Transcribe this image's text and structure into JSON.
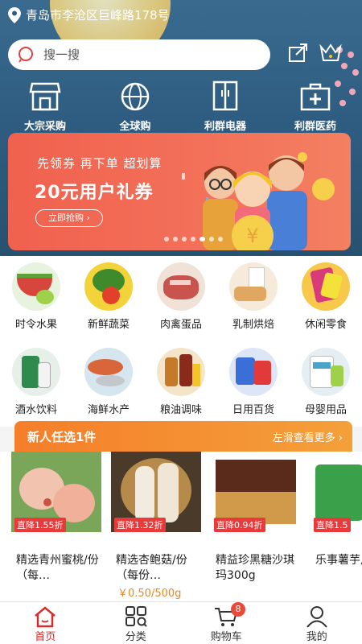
{
  "header": {
    "location": "青岛市李沧区巨峰路178号",
    "search_placeholder": "搜一搜",
    "share_icon": "share-icon",
    "crown_icon": "crown-basket-icon"
  },
  "categories_top": [
    {
      "label": "大宗采购",
      "icon": "store-icon"
    },
    {
      "label": "全球购",
      "icon": "globe-icon"
    },
    {
      "label": "利群电器",
      "icon": "fridge-icon"
    },
    {
      "label": "利群医药",
      "icon": "medkit-icon"
    }
  ],
  "banner": {
    "line1": "先领券 再下单 超划算",
    "line2": "20元用户礼券",
    "button": "立即抢购 ›",
    "dots_total": 7,
    "dots_active": 5
  },
  "grid": [
    {
      "label": "时令水果",
      "color": "#7cc34a"
    },
    {
      "label": "新鲜蔬菜",
      "color": "#4e9a3a"
    },
    {
      "label": "肉禽蛋品",
      "color": "#c9544d"
    },
    {
      "label": "乳制烘焙",
      "color": "#e8c79a"
    },
    {
      "label": "休闲零食",
      "color": "#f0b73a"
    },
    {
      "label": "酒水饮料",
      "color": "#2f8a4e"
    },
    {
      "label": "海鲜水产",
      "color": "#d8663a"
    },
    {
      "label": "粮油调味",
      "color": "#c47a2a"
    },
    {
      "label": "日用百货",
      "color": "#3a6fd8"
    },
    {
      "label": "母婴用品",
      "color": "#4aa3c8"
    }
  ],
  "new_user": {
    "title": "新人任选1件",
    "more": "左滑查看更多 ›"
  },
  "products": [
    {
      "tag": "直降1.55折",
      "name": "精选青州蜜桃/份（每…",
      "price": ""
    },
    {
      "tag": "直降1.32折",
      "name": "精选杏鲍菇/份（每份…",
      "price": "￥0.50/500g"
    },
    {
      "tag": "直降0.94折",
      "name": "精益珍黑糖沙琪玛300g",
      "price": ""
    },
    {
      "tag": "直降1.5",
      "name": "乐事薯芋片沁",
      "price": ""
    }
  ],
  "tabbar": [
    {
      "label": "首页",
      "icon": "home-icon",
      "active": true
    },
    {
      "label": "分类",
      "icon": "category-icon",
      "active": false
    },
    {
      "label": "购物车",
      "icon": "cart-icon",
      "active": false,
      "badge": "8"
    },
    {
      "label": "我的",
      "icon": "user-icon",
      "active": false
    }
  ]
}
